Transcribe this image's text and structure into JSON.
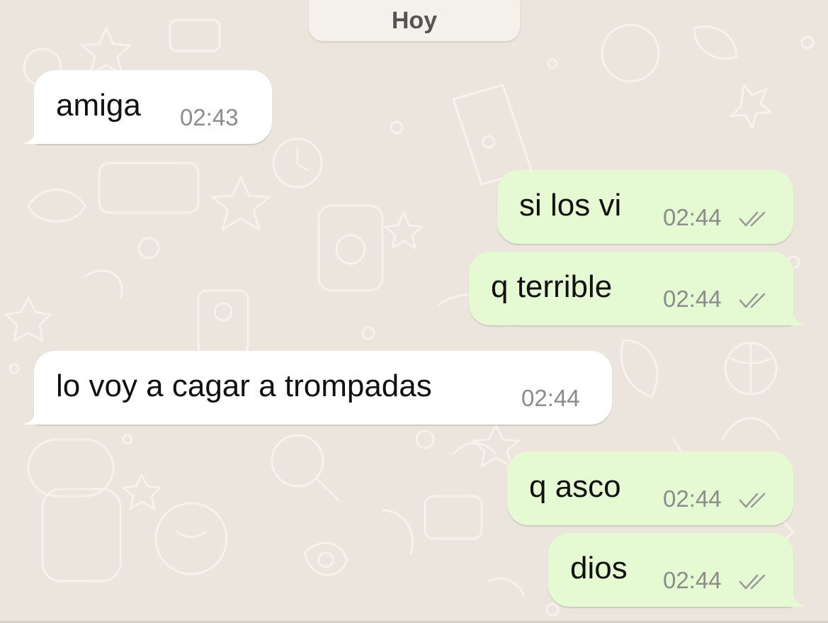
{
  "chat": {
    "day_label": "Hoy",
    "messages": [
      {
        "direction": "incoming",
        "text": "amiga",
        "time": "02:43",
        "ticks_icon": ""
      },
      {
        "direction": "outgoing",
        "text": "si los vi",
        "time": "02:44",
        "ticks_icon": "double-check-icon"
      },
      {
        "direction": "outgoing",
        "text": "q terrible",
        "time": "02:44",
        "ticks_icon": "double-check-icon"
      },
      {
        "direction": "incoming",
        "text": "lo voy a cagar a trompadas",
        "time": "02:44",
        "ticks_icon": ""
      },
      {
        "direction": "outgoing",
        "text": "q asco",
        "time": "02:44",
        "ticks_icon": "double-check-icon"
      },
      {
        "direction": "outgoing",
        "text": "dios",
        "time": "02:44",
        "ticks_icon": "double-check-icon"
      }
    ]
  },
  "colors": {
    "background": "#ebe5dd",
    "incoming_bubble": "#ffffff",
    "outgoing_bubble": "#e5fad3",
    "time_text": "#8c8c8c",
    "tick_color": "#9a9a9a"
  }
}
